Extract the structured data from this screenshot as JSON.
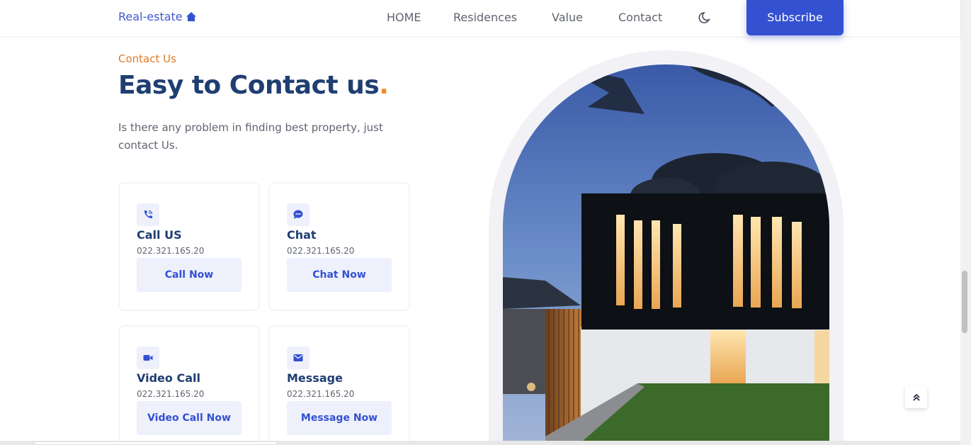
{
  "header": {
    "logo_text": "Real-estate",
    "logo_icon": "home-icon",
    "nav": [
      "HOME",
      "Residences",
      "Value",
      "Contact"
    ],
    "theme_icon": "moon-icon",
    "subscribe_label": "Subscribe"
  },
  "contact": {
    "eyebrow": "Contact Us",
    "title": "Easy to Contact us",
    "title_dot": ".",
    "description": "Is there any problem in finding best property, just contact Us."
  },
  "cards": [
    {
      "title": "Call US",
      "number": "022.321.165.20",
      "button": "Call Now",
      "icon": "phone-icon"
    },
    {
      "title": "Chat",
      "number": "022.321.165.20",
      "button": "Chat Now",
      "icon": "chat-icon"
    },
    {
      "title": "Video Call",
      "number": "022.321.165.20",
      "button": "Video Call Now",
      "icon": "video-icon"
    },
    {
      "title": "Message",
      "number": "022.321.165.20",
      "button": "Message Now",
      "icon": "mail-icon"
    }
  ],
  "colors": {
    "accent": "#3451d1",
    "title": "#1f3e72",
    "eyebrow": "#e07b27",
    "icon_bg": "#eef0fc"
  },
  "image": {
    "subject": "modern house at dusk"
  },
  "scroll_top_icon": "chevrons-up-icon"
}
